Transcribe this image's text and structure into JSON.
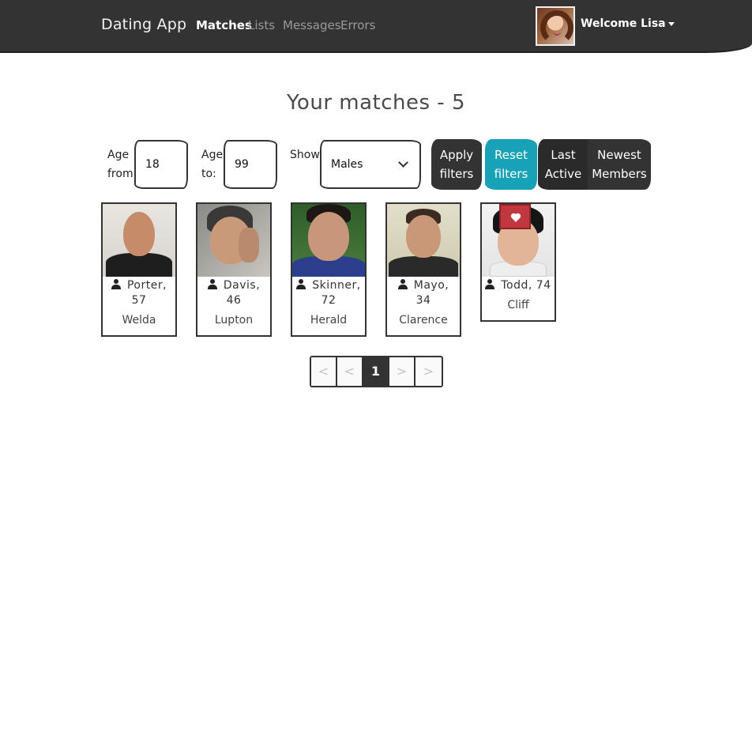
{
  "nav": {
    "brand": "Dating App",
    "links": [
      {
        "label": "Matches",
        "active": true
      },
      {
        "label": "Lists",
        "active": false
      },
      {
        "label": "Messages",
        "active": false
      },
      {
        "label": "Errors",
        "active": false
      }
    ],
    "user": {
      "welcome": "Welcome Lisa",
      "avatar_icon": "user-avatar"
    }
  },
  "title": "Your matches - 5",
  "filters": {
    "age_from_label_1": "Age",
    "age_from_label_2": "from:",
    "age_from_value": "18",
    "age_to_label_1": "Age",
    "age_to_label_2": "to:",
    "age_to_value": "99",
    "show_label": "Show:",
    "gender_value": "Males",
    "apply_label_1": "Apply",
    "apply_label_2": "filters",
    "reset_label_1": "Reset",
    "reset_label_2": "filters",
    "last_active_1": "Last",
    "last_active_2": "Active",
    "newest_1": "Newest",
    "newest_2": "Members"
  },
  "members": [
    {
      "name_age_1": "Porter,",
      "name_age_2": "57",
      "city": "Welda",
      "liked": false
    },
    {
      "name_age_1": "Davis,",
      "name_age_2": "46",
      "city": "Lupton",
      "liked": false
    },
    {
      "name_age_1": "Skinner,",
      "name_age_2": "72",
      "city": "Herald",
      "liked": false
    },
    {
      "name_age_1": "Mayo,",
      "name_age_2": "34",
      "city": "Clarence",
      "liked": false
    },
    {
      "name_age_1": "Todd, 74",
      "name_age_2": "",
      "city": "Cliff",
      "liked": true
    }
  ],
  "pagination": {
    "first": "<",
    "prev": "<",
    "current": "1",
    "next": ">",
    "last": ">"
  },
  "colors": {
    "navbar": "#333333",
    "teal": "#17a2b8",
    "like": "#c0373f"
  }
}
